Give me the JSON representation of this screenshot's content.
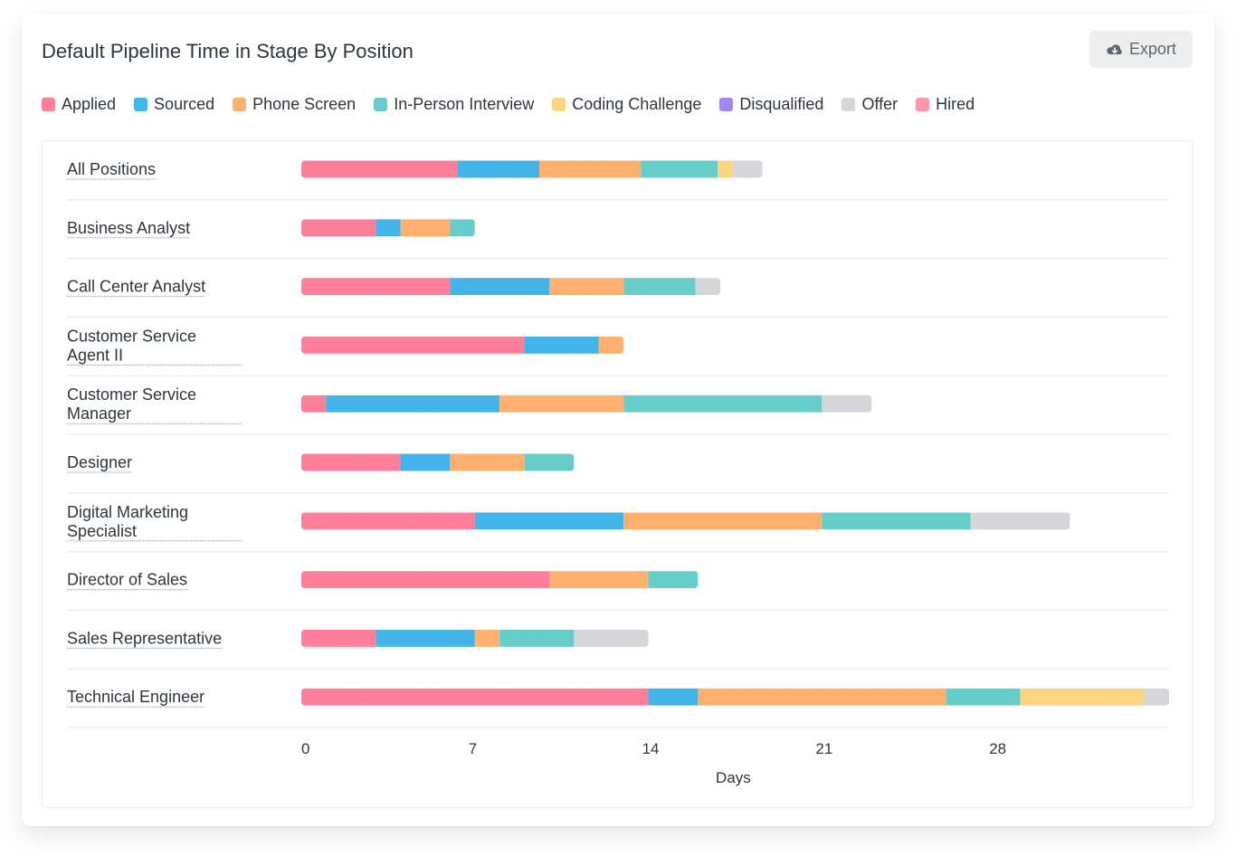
{
  "header": {
    "title": "Default Pipeline Time in Stage By Position",
    "export_label": "Export",
    "export_icon": "cloud-download-icon"
  },
  "chart_data": {
    "type": "bar",
    "orientation": "horizontal",
    "stacked": true,
    "title": "Default Pipeline Time in Stage By Position",
    "xlabel": "Days",
    "ylabel": "",
    "xlim": [
      0,
      35
    ],
    "xticks": [
      0,
      7,
      14,
      21,
      28
    ],
    "grid": false,
    "legend_position": "top-left",
    "categories": [
      [
        "All Positions"
      ],
      [
        "Business Analyst"
      ],
      [
        "Call Center Analyst"
      ],
      [
        "Customer Service",
        "Agent II"
      ],
      [
        "Customer Service",
        "Manager"
      ],
      [
        "Designer"
      ],
      [
        "Digital Marketing",
        "Specialist"
      ],
      [
        "Director of Sales"
      ],
      [
        "Sales Representative"
      ],
      [
        "Technical Engineer"
      ]
    ],
    "series": [
      {
        "name": "Applied",
        "color": "#ff7f9b",
        "values": [
          6.3,
          3.0,
          6.0,
          9.0,
          1.0,
          4.0,
          7.0,
          10.0,
          3.0,
          14.0
        ]
      },
      {
        "name": "Sourced",
        "color": "#42b4ea",
        "values": [
          3.3,
          1.0,
          4.0,
          3.0,
          7.0,
          2.0,
          6.0,
          0,
          4.0,
          2.0
        ]
      },
      {
        "name": "Phone Screen",
        "color": "#ffb06e",
        "values": [
          4.1,
          2.0,
          3.0,
          1.0,
          5.0,
          3.0,
          8.0,
          4.0,
          1.0,
          10.0
        ]
      },
      {
        "name": "In-Person Interview",
        "color": "#67cdcb",
        "values": [
          3.1,
          1.0,
          2.9,
          0,
          8.0,
          2.0,
          6.0,
          2.0,
          3.0,
          3.0
        ]
      },
      {
        "name": "Coding Challenge",
        "color": "#fdd47f",
        "values": [
          0.6,
          0,
          0,
          0,
          0,
          0,
          0,
          0,
          0,
          5.0
        ]
      },
      {
        "name": "Disqualified",
        "color": "#a585f5",
        "values": [
          0,
          0,
          0,
          0,
          0,
          0,
          0,
          0,
          0,
          0
        ]
      },
      {
        "name": "Offer",
        "color": "#d4d6da",
        "values": [
          1.2,
          0,
          1.0,
          0,
          2.0,
          0,
          4.0,
          0,
          3.0,
          1.0
        ]
      },
      {
        "name": "Hired",
        "color": "#ff97aa",
        "values": [
          0,
          0,
          0,
          0,
          0,
          0,
          0,
          0,
          0,
          0
        ]
      }
    ]
  }
}
